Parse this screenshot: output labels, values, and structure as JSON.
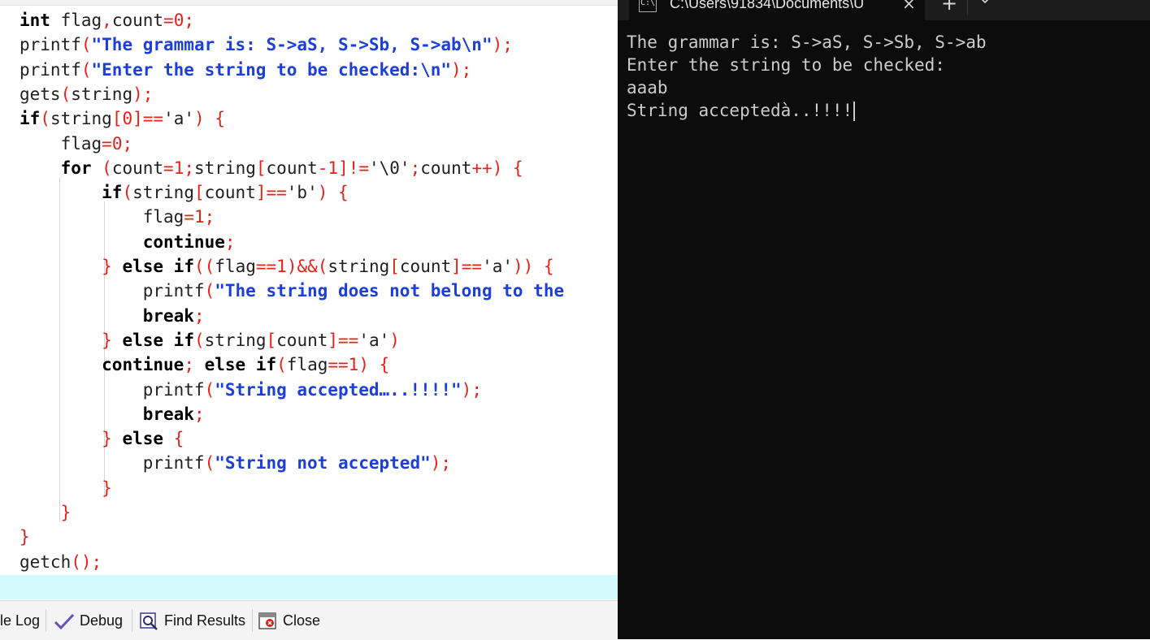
{
  "editor": {
    "lines": [
      [
        [
          "kw",
          "int"
        ],
        [
          "plain",
          " flag"
        ],
        [
          "op",
          ","
        ],
        [
          "plain",
          "count"
        ],
        [
          "op",
          "="
        ],
        [
          "num",
          "0"
        ],
        [
          "op",
          ";"
        ]
      ],
      [
        [
          "plain",
          "printf"
        ],
        [
          "op",
          "("
        ],
        [
          "str",
          "\"The grammar is: S->aS, S->Sb, S->ab\\n\""
        ],
        [
          "op",
          ");"
        ]
      ],
      [
        [
          "plain",
          "printf"
        ],
        [
          "op",
          "("
        ],
        [
          "str",
          "\"Enter the string to be checked:\\n\""
        ],
        [
          "op",
          ");"
        ]
      ],
      [
        [
          "plain",
          "gets"
        ],
        [
          "op",
          "("
        ],
        [
          "plain",
          "string"
        ],
        [
          "op",
          ");"
        ]
      ],
      [
        [
          "kw",
          "if"
        ],
        [
          "op",
          "("
        ],
        [
          "plain",
          "string"
        ],
        [
          "op",
          "["
        ],
        [
          "num",
          "0"
        ],
        [
          "op",
          "]=="
        ],
        [
          "plain",
          "'a'"
        ],
        [
          "op",
          ")"
        ],
        [
          "plain",
          " "
        ],
        [
          "op",
          "{"
        ]
      ],
      [
        [
          "plain",
          "    flag"
        ],
        [
          "op",
          "="
        ],
        [
          "num",
          "0"
        ],
        [
          "op",
          ";"
        ]
      ],
      [
        [
          "plain",
          "    "
        ],
        [
          "kw",
          "for"
        ],
        [
          "plain",
          " "
        ],
        [
          "op",
          "("
        ],
        [
          "plain",
          "count"
        ],
        [
          "op",
          "="
        ],
        [
          "num",
          "1"
        ],
        [
          "op",
          ";"
        ],
        [
          "plain",
          "string"
        ],
        [
          "op",
          "["
        ],
        [
          "plain",
          "count"
        ],
        [
          "op",
          "-"
        ],
        [
          "num",
          "1"
        ],
        [
          "op",
          "]!="
        ],
        [
          "plain",
          "'\\0'"
        ],
        [
          "op",
          ";"
        ],
        [
          "plain",
          "count"
        ],
        [
          "op",
          "++)"
        ],
        [
          "plain",
          " "
        ],
        [
          "op",
          "{"
        ]
      ],
      [
        [
          "plain",
          "        "
        ],
        [
          "kw",
          "if"
        ],
        [
          "op",
          "("
        ],
        [
          "plain",
          "string"
        ],
        [
          "op",
          "["
        ],
        [
          "plain",
          "count"
        ],
        [
          "op",
          "]=="
        ],
        [
          "plain",
          "'b'"
        ],
        [
          "op",
          ")"
        ],
        [
          "plain",
          " "
        ],
        [
          "op",
          "{"
        ]
      ],
      [
        [
          "plain",
          "            flag"
        ],
        [
          "op",
          "="
        ],
        [
          "num",
          "1"
        ],
        [
          "op",
          ";"
        ]
      ],
      [
        [
          "plain",
          "            "
        ],
        [
          "kw",
          "continue"
        ],
        [
          "op",
          ";"
        ]
      ],
      [
        [
          "plain",
          "        "
        ],
        [
          "op",
          "}"
        ],
        [
          "plain",
          " "
        ],
        [
          "kw",
          "else if"
        ],
        [
          "op",
          "(("
        ],
        [
          "plain",
          "flag"
        ],
        [
          "op",
          "=="
        ],
        [
          "num",
          "1"
        ],
        [
          "op",
          ")&&("
        ],
        [
          "plain",
          "string"
        ],
        [
          "op",
          "["
        ],
        [
          "plain",
          "count"
        ],
        [
          "op",
          "]=="
        ],
        [
          "plain",
          "'a'"
        ],
        [
          "op",
          "))"
        ],
        [
          "plain",
          " "
        ],
        [
          "op",
          "{"
        ]
      ],
      [
        [
          "plain",
          "            printf"
        ],
        [
          "op",
          "("
        ],
        [
          "str",
          "\"The string does not belong to the"
        ]
      ],
      [
        [
          "plain",
          "            "
        ],
        [
          "kw",
          "break"
        ],
        [
          "op",
          ";"
        ]
      ],
      [
        [
          "plain",
          "        "
        ],
        [
          "op",
          "}"
        ],
        [
          "plain",
          " "
        ],
        [
          "kw",
          "else if"
        ],
        [
          "op",
          "("
        ],
        [
          "plain",
          "string"
        ],
        [
          "op",
          "["
        ],
        [
          "plain",
          "count"
        ],
        [
          "op",
          "]=="
        ],
        [
          "plain",
          "'a'"
        ],
        [
          "op",
          ")"
        ]
      ],
      [
        [
          "plain",
          "        "
        ],
        [
          "kw",
          "continue"
        ],
        [
          "op",
          ";"
        ],
        [
          "plain",
          " "
        ],
        [
          "kw",
          "else if"
        ],
        [
          "op",
          "("
        ],
        [
          "plain",
          "flag"
        ],
        [
          "op",
          "=="
        ],
        [
          "num",
          "1"
        ],
        [
          "op",
          ")"
        ],
        [
          "plain",
          " "
        ],
        [
          "op",
          "{"
        ]
      ],
      [
        [
          "plain",
          "            printf"
        ],
        [
          "op",
          "("
        ],
        [
          "str",
          "\"String accepted…..!!!!\""
        ],
        [
          "op",
          ");"
        ]
      ],
      [
        [
          "plain",
          "            "
        ],
        [
          "kw",
          "break"
        ],
        [
          "op",
          ";"
        ]
      ],
      [
        [
          "plain",
          "        "
        ],
        [
          "op",
          "}"
        ],
        [
          "plain",
          " "
        ],
        [
          "kw",
          "else"
        ],
        [
          "plain",
          " "
        ],
        [
          "op",
          "{"
        ]
      ],
      [
        [
          "plain",
          "            printf"
        ],
        [
          "op",
          "("
        ],
        [
          "str",
          "\"String not accepted\""
        ],
        [
          "op",
          ");"
        ]
      ],
      [
        [
          "plain",
          "        "
        ],
        [
          "op",
          "}"
        ]
      ],
      [
        [
          "plain",
          "    "
        ],
        [
          "op",
          "}"
        ]
      ],
      [
        [
          "op",
          "}"
        ]
      ],
      [
        [
          "plain",
          "getch"
        ],
        [
          "op",
          "();"
        ]
      ]
    ]
  },
  "bottom_panel": {
    "tabs": [
      {
        "label": "le Log",
        "icon": "compile-log-icon"
      },
      {
        "label": "Debug",
        "icon": "debug-check-icon"
      },
      {
        "label": "Find Results",
        "icon": "find-results-icon"
      },
      {
        "label": "Close",
        "icon": "close-panel-icon"
      }
    ]
  },
  "terminal": {
    "tab_title": "C:\\Users\\91834\\Documents\\U",
    "tab_icon": "console-icon",
    "close_glyph": "×",
    "new_tab_glyph": "+",
    "dropdown_icon": "chevron-down-icon",
    "output_lines": [
      "The grammar is: S->aS, S->Sb, S->ab",
      "Enter the string to be checked:",
      "aaab",
      "String acceptedà..!!!!"
    ]
  },
  "colors": {
    "keyword": "#000000",
    "operator": "#e8201a",
    "string": "#1b3fd8",
    "current_line": "#d4fbff",
    "terminal_bg": "#0c0c0c",
    "terminal_text": "#cccccc"
  }
}
